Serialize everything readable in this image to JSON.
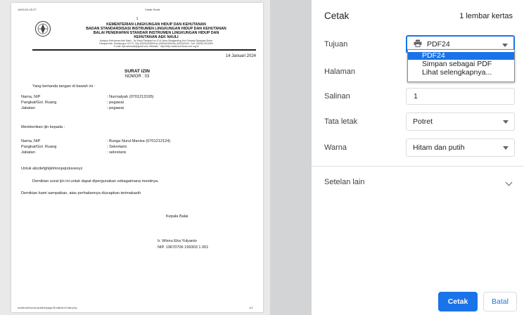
{
  "preview": {
    "header_datetime": "14/01/24 15.27",
    "header_title": "Cetak Surat",
    "page_number_top": "1",
    "kop": {
      "line1": "KEMENTERIAN LINGKUNGAN HIDUP DAN KEHUTANAN",
      "line2": "BADAN STANDARDISASI INSTRUMEN LINGKUNGAN HIDUP DAN KEHUTANAN",
      "line3": "BALAI PENERAPAN STANDAR INSTRUMEN LINGKUNGAN HIDUP DAN",
      "line4": "KEHUTANAN AEK NAULI",
      "address1": "Kampus Kehutanan Aek Nauli , Jln Raya Parapat Km 10.5 Desa Sibaganding Kec Girsang Sipangan Bolon",
      "address2": "Parapat Kab. Simalungun 21174, Telp.(0625)41659/Fax.(0625)41653/Hp (0625)/0021, Fax: (0625) 0021563",
      "address3": "E-mail: bpk.aeknauli@gmail.com /Website : http://http://aeknauli.forda-mof.org.id"
    },
    "letter_date": "14 Januari 2024",
    "title": "SURAT IZIN",
    "nomor": "NOMOR : 03",
    "intro": "Yang bertanda tangan di bawah ini :",
    "signer": [
      {
        "label": "Nama, NIP",
        "value": ": Nurmalyah (0701213195)"
      },
      {
        "label": "Pangkat/Gol. Ruang",
        "value": ": pegawai"
      },
      {
        "label": "Jabatan",
        "value": ": pegawai"
      }
    ],
    "grant_line": "Memberikan ijin kepada :",
    "recipient": [
      {
        "label": "Nama, NIP",
        "value": ": Bunga Nurul Manisa (0701212124)"
      },
      {
        "label": "Pangkat/Gol. Ruang",
        "value": ": Sekretaris"
      },
      {
        "label": "Jabatan",
        "value": ": sekretaris"
      }
    ],
    "purpose": "Untuk abcdefghijklmnopqrstuvwxyz",
    "closing1": "Demikian surat ijin ini untuk dapat dipergunakan sebagaimana mestinya.",
    "closing2": "Demikian kami sampaikan, atas perhatiannya diucapkan terimakasih",
    "sign_role": "Kepala Balai",
    "sign_name": "Ir. Wisnu Eka Yulyanto",
    "sign_nip": "NIP. 19670706 199303 1 001",
    "footer_url": "localhost/surat-bpsilhk/page/SuratIzinCetak.php",
    "footer_page": "1/1"
  },
  "panel": {
    "title": "Cetak",
    "sheet_count": "1 lembar kertas",
    "destination_label": "Tujuan",
    "destination_value": "PDF24",
    "destination_options": [
      "PDF24",
      "Simpan sebagai PDF",
      "Lihat selengkapnya..."
    ],
    "pages_label": "Halaman",
    "copies_label": "Salinan",
    "copies_value": "1",
    "layout_label": "Tata letak",
    "layout_value": "Potret",
    "color_label": "Warna",
    "color_value": "Hitam dan putih",
    "more_settings_label": "Setelan lain",
    "print_button": "Cetak",
    "cancel_button": "Batal"
  },
  "colors": {
    "accent": "#1a73e8",
    "preview_bg": "#e9e9e9",
    "scroll_gutter": "#d2d4d6"
  },
  "icons": {
    "destination": "printer-icon",
    "dropdown": "chevron-down-icon",
    "more_settings": "chevron-down-icon"
  }
}
